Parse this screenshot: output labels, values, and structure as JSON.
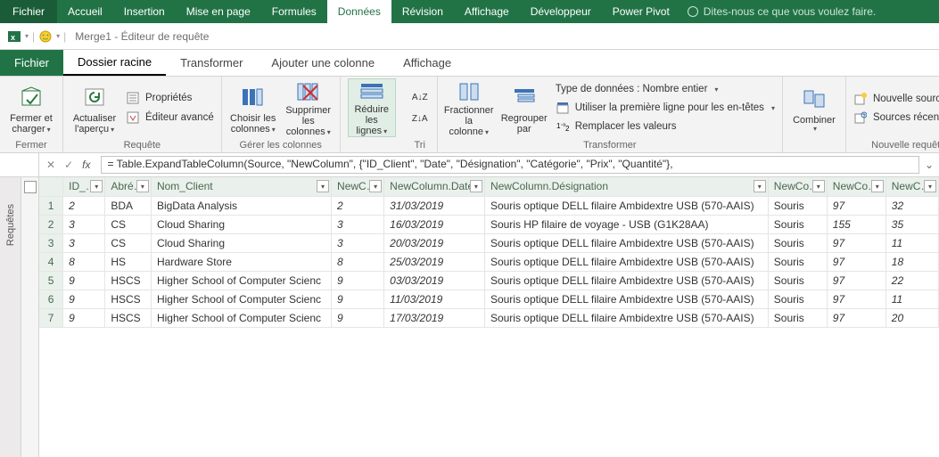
{
  "excel_tabs": [
    "Fichier",
    "Accueil",
    "Insertion",
    "Mise en page",
    "Formules",
    "Données",
    "Révision",
    "Affichage",
    "Développeur",
    "Power Pivot"
  ],
  "excel_active_tab": 5,
  "tellme": "Dites-nous ce que vous voulez faire.",
  "qat_title": "Merge1 - Éditeur de requête",
  "pq_tabs": [
    "Fichier",
    "Dossier racine",
    "Transformer",
    "Ajouter une colonne",
    "Affichage"
  ],
  "pq_active_tab": 1,
  "ribbon": {
    "close": {
      "label1": "Fermer et",
      "label2": "charger"
    },
    "refresh": {
      "label1": "Actualiser",
      "label2": "l'aperçu"
    },
    "props": "Propriétés",
    "advanced_editor": "Éditeur avancé",
    "choose": {
      "label1": "Choisir les",
      "label2": "colonnes"
    },
    "delete": {
      "label1": "Supprimer les",
      "label2": "colonnes"
    },
    "reduce": {
      "label1": "Réduire les",
      "label2": "lignes"
    },
    "split": {
      "label1": "Fractionner",
      "label2": "la colonne"
    },
    "group": {
      "label1": "Regrouper",
      "label2": "par"
    },
    "datatype": "Type de données : Nombre entier",
    "firstrow": "Utiliser la première ligne pour les en-têtes",
    "replace": "Remplacer les valeurs",
    "combine": "Combiner",
    "new_source": "Nouvelle source",
    "recent_sources": "Sources récentes",
    "group_close": "Fermer",
    "group_query": "Requête",
    "group_cols": "Gérer les colonnes",
    "group_sort": "Tri",
    "group_transform": "Transformer",
    "group_newq": "Nouvelle requête"
  },
  "left_rail": "Requêtes",
  "fx": "= Table.ExpandTableColumn(Source, \"NewColumn\", {\"ID_Client\", \"Date\", \"Désignation\", \"Catégorie\", \"Prix\", \"Quantité\"},",
  "columns": [
    "ID_…",
    "Abré…",
    "Nom_Client",
    "NewC…",
    "NewColumn.Date",
    "NewColumn.Désignation",
    "NewCo…",
    "NewCo…",
    "NewC…"
  ],
  "rows": [
    {
      "n": 1,
      "id": 2,
      "abbr": "BDA",
      "nom": "BigData Analysis",
      "newc": 2,
      "date": "31/03/2019",
      "desig": "Souris optique DELL filaire Ambidextre USB (570-AAIS)",
      "cat": "Souris",
      "prix": 97,
      "qte": 32
    },
    {
      "n": 2,
      "id": 3,
      "abbr": "CS",
      "nom": "Cloud Sharing",
      "newc": 3,
      "date": "16/03/2019",
      "desig": "Souris HP filaire de voyage - USB (G1K28AA)",
      "cat": "Souris",
      "prix": 155,
      "qte": 35
    },
    {
      "n": 3,
      "id": 3,
      "abbr": "CS",
      "nom": "Cloud Sharing",
      "newc": 3,
      "date": "20/03/2019",
      "desig": "Souris optique DELL filaire Ambidextre USB (570-AAIS)",
      "cat": "Souris",
      "prix": 97,
      "qte": 11
    },
    {
      "n": 4,
      "id": 8,
      "abbr": "HS",
      "nom": "Hardware Store",
      "newc": 8,
      "date": "25/03/2019",
      "desig": "Souris optique DELL filaire Ambidextre USB (570-AAIS)",
      "cat": "Souris",
      "prix": 97,
      "qte": 18
    },
    {
      "n": 5,
      "id": 9,
      "abbr": "HSCS",
      "nom": "Higher School of Computer Scienc",
      "newc": 9,
      "date": "03/03/2019",
      "desig": "Souris optique DELL filaire Ambidextre USB (570-AAIS)",
      "cat": "Souris",
      "prix": 97,
      "qte": 22
    },
    {
      "n": 6,
      "id": 9,
      "abbr": "HSCS",
      "nom": "Higher School of Computer Scienc",
      "newc": 9,
      "date": "11/03/2019",
      "desig": "Souris optique DELL filaire Ambidextre USB (570-AAIS)",
      "cat": "Souris",
      "prix": 97,
      "qte": 11
    },
    {
      "n": 7,
      "id": 9,
      "abbr": "HSCS",
      "nom": "Higher School of Computer Scienc",
      "newc": 9,
      "date": "17/03/2019",
      "desig": "Souris optique DELL filaire Ambidextre USB (570-AAIS)",
      "cat": "Souris",
      "prix": 97,
      "qte": 20
    }
  ]
}
